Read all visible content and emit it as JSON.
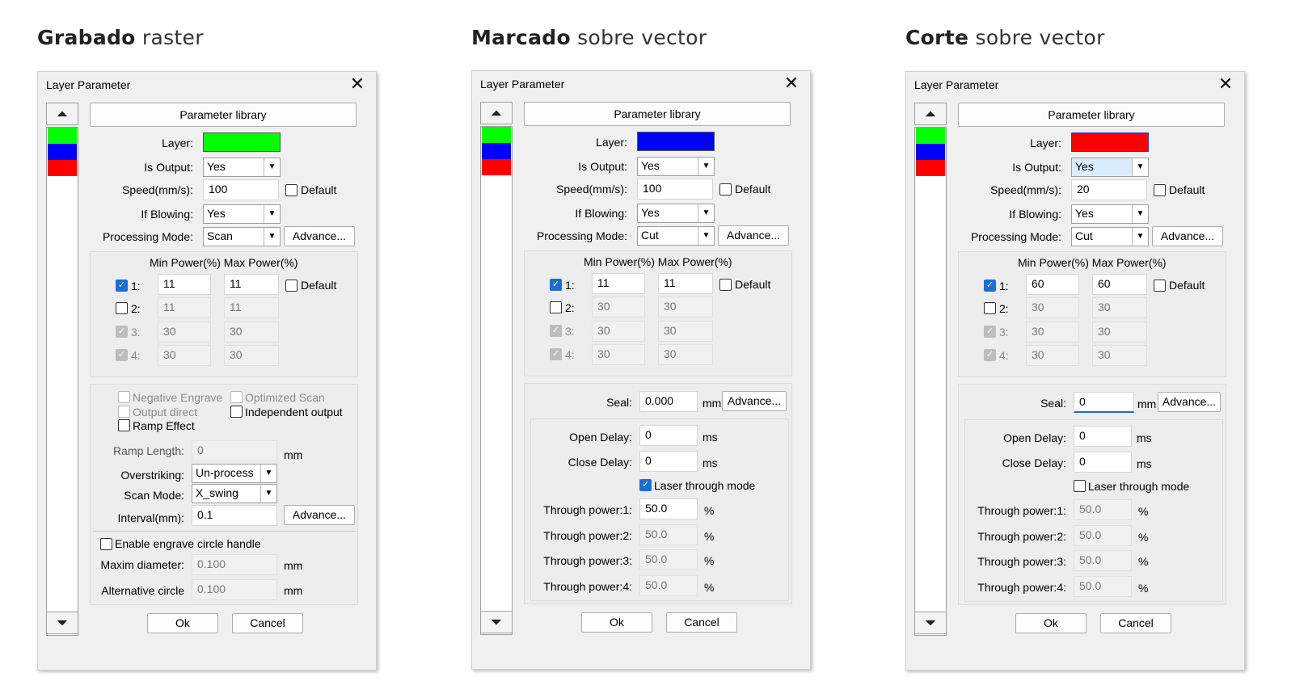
{
  "headings": [
    {
      "bold": "Grabado",
      "rest": " raster"
    },
    {
      "bold": "Marcado",
      "rest": " sobre vector"
    },
    {
      "bold": "Corte",
      "rest": " sobre vector"
    }
  ],
  "dialog": {
    "title": "Layer Parameter",
    "close": "✕",
    "param_library": "Parameter library",
    "layer_label": "Layer:",
    "is_output_label": "Is Output:",
    "speed_label": "Speed(mm/s):",
    "if_blowing_label": "If Blowing:",
    "processing_mode_label": "Processing Mode:",
    "advance": "Advance...",
    "default": "Default",
    "power_header": "Min Power(%) Max Power(%)",
    "row1": "1:",
    "row2": "2:",
    "row3": "3:",
    "row4": "4:",
    "ok": "Ok",
    "cancel": "Cancel",
    "up": "⏶",
    "down": "⏷",
    "layer_colors": [
      "#00ff00",
      "#0000ff",
      "#ff0000"
    ]
  },
  "engrave": {
    "layer_color": "#00ff00",
    "is_output": "Yes",
    "speed": "100",
    "if_blowing": "Yes",
    "processing_mode": "Scan",
    "p1_min": "11",
    "p1_max": "11",
    "p2_min": "11",
    "p2_max": "11",
    "p3_min": "30",
    "p3_max": "30",
    "p4_min": "30",
    "p4_max": "30",
    "negative_engrave": "Negative Engrave",
    "optimized_scan": "Optimized Scan",
    "output_direct": "Output direct",
    "independent_output": "Independent output",
    "ramp_effect": "Ramp Effect",
    "ramp_length_label": "Ramp Length:",
    "ramp_length": "0",
    "mm": "mm",
    "overstriking_label": "Overstriking:",
    "overstriking": "Un-process",
    "scan_mode_label": "Scan Mode:",
    "scan_mode": "X_swing",
    "interval_label": "Interval(mm):",
    "interval": "0.1",
    "circle_handle": "Enable engrave circle handle",
    "maxim_diameter_label": "Maxim diameter:",
    "maxim_diameter": "0.100",
    "alternative_circle_label": "Alternative circle",
    "alternative_circle": "0.100"
  },
  "mark": {
    "layer_color": "#0000ff",
    "is_output": "Yes",
    "speed": "100",
    "if_blowing": "Yes",
    "processing_mode": "Cut",
    "p1_min": "11",
    "p1_max": "11",
    "p2_min": "30",
    "p2_max": "30",
    "p3_min": "30",
    "p3_max": "30",
    "p4_min": "30",
    "p4_max": "30",
    "seal_label": "Seal:",
    "seal": "0.000",
    "mm": "mm",
    "ms": "ms",
    "percent": "%",
    "open_delay_label": "Open Delay:",
    "open_delay": "0",
    "close_delay_label": "Close Delay:",
    "close_delay": "0",
    "laser_through": "Laser through mode",
    "tp1_label": "Through power:1:",
    "tp1": "50.0",
    "tp2_label": "Through power:2:",
    "tp2": "50.0",
    "tp3_label": "Through power:3:",
    "tp3": "50.0",
    "tp4_label": "Through power:4:",
    "tp4": "50.0"
  },
  "cut": {
    "layer_color": "#ff0000",
    "is_output": "Yes",
    "speed": "20",
    "if_blowing": "Yes",
    "processing_mode": "Cut",
    "p1_min": "60",
    "p1_max": "60",
    "p2_min": "30",
    "p2_max": "30",
    "p3_min": "30",
    "p3_max": "30",
    "p4_min": "30",
    "p4_max": "30",
    "seal_label": "Seal:",
    "seal": "0",
    "mm": "mm",
    "ms": "ms",
    "percent": "%",
    "open_delay_label": "Open Delay:",
    "open_delay": "0",
    "close_delay_label": "Close Delay:",
    "close_delay": "0",
    "laser_through": "Laser through mode",
    "tp1_label": "Through power:1:",
    "tp1": "50.0",
    "tp2_label": "Through power:2:",
    "tp2": "50.0",
    "tp3_label": "Through power:3:",
    "tp3": "50.0",
    "tp4_label": "Through power:4:",
    "tp4": "50.0"
  }
}
